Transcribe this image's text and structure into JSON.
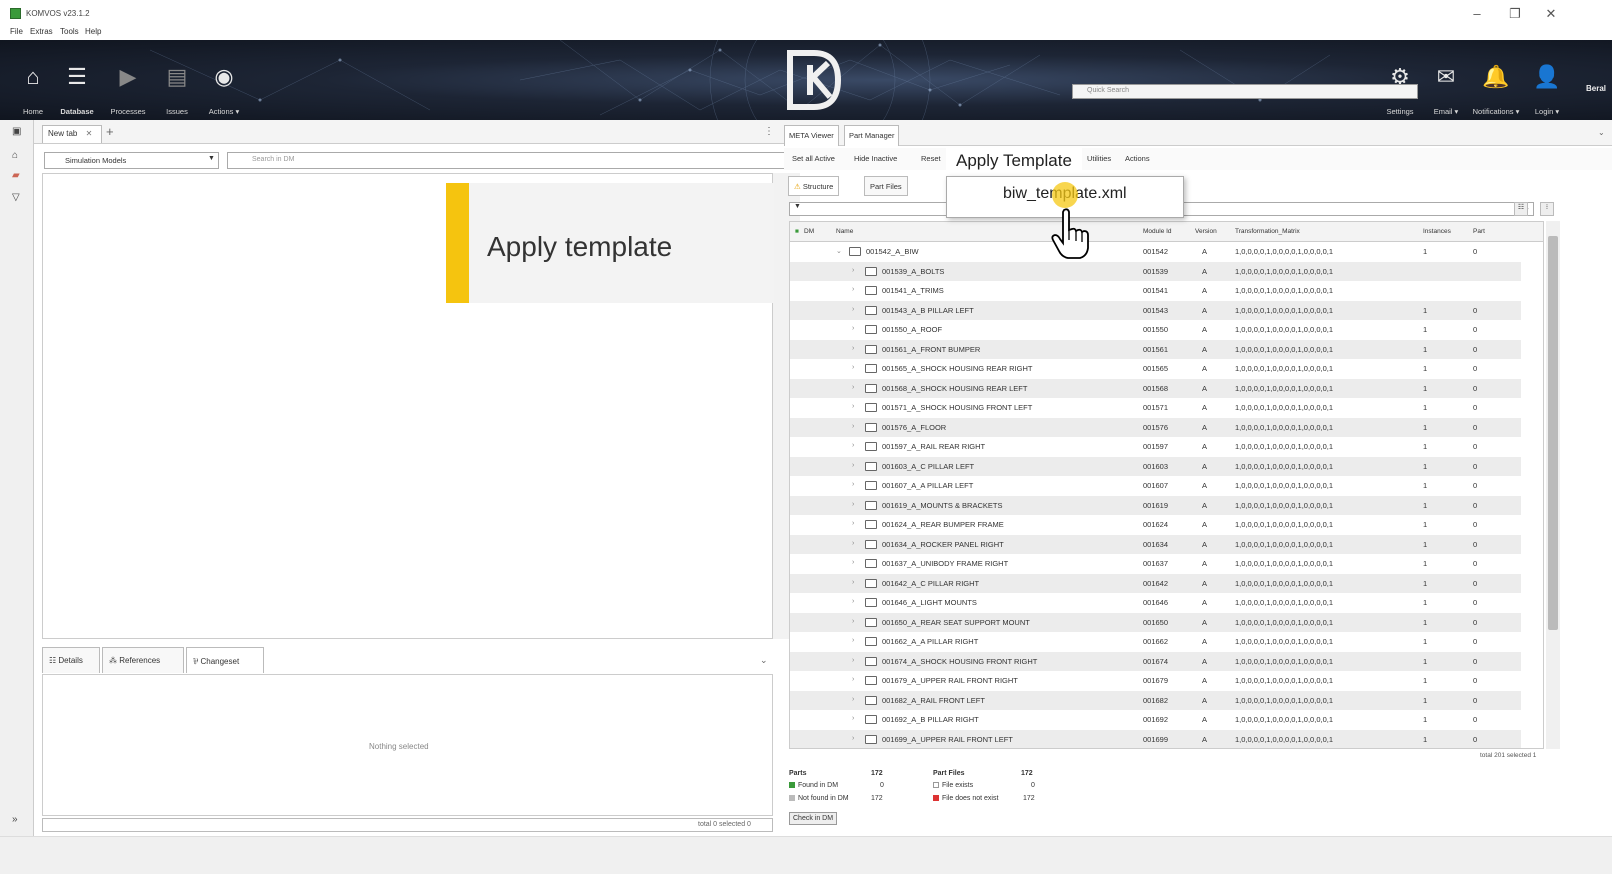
{
  "window": {
    "title": "KOMVOS v23.1.2",
    "minimize": "–",
    "maximize": "❐",
    "close": "✕"
  },
  "menu": [
    "File",
    "Extras",
    "Tools",
    "Help"
  ],
  "toolbar": {
    "items": [
      {
        "label": "Home",
        "icon": "home-icon"
      },
      {
        "label": "Database",
        "icon": "database-icon"
      },
      {
        "label": "Processes",
        "icon": "play-icon"
      },
      {
        "label": "Issues",
        "icon": "document-icon"
      },
      {
        "label": "Actions ▾",
        "icon": "broadcast-icon"
      }
    ],
    "right_items": [
      {
        "label": "Settings",
        "icon": "gear-icon"
      },
      {
        "label": "Email ▾",
        "icon": "email-icon"
      },
      {
        "label": "Notifications ▾",
        "icon": "bell-icon"
      },
      {
        "label": "Login ▾",
        "icon": "user-icon"
      }
    ],
    "quick_search_placeholder": "Quick Search",
    "user": "Beral"
  },
  "left": {
    "tab_label": "New tab",
    "dropdown_value": "Simulation Models",
    "search_placeholder": "Search in DM",
    "bottom_tabs": [
      "Details",
      "References",
      "Changeset"
    ],
    "nothing_selected": "Nothing selected",
    "status": "total 0 selected 0"
  },
  "callout": {
    "text": "Apply template",
    "color": "#f5c40f"
  },
  "right": {
    "tabs": [
      "META Viewer",
      "Part Manager"
    ],
    "toolbar": [
      "Set all Active",
      "Hide Inactive",
      "Reset",
      "Utilities",
      "Actions"
    ],
    "struct_tabs": [
      "Structure",
      "Part Files"
    ],
    "columns": [
      "DM",
      "Name",
      "Module Id",
      "Version",
      "Transformation_Matrix",
      "Instances",
      "Part"
    ],
    "rows": [
      {
        "name": "001542_A_BIW",
        "module": "001542",
        "version": "A",
        "matrix": "1,0,0,0,0,1,0,0,0,0,1,0,0,0,0,1",
        "instances": "1",
        "part": "0",
        "level": 0,
        "expanded": true
      },
      {
        "name": "001539_A_BOLTS",
        "module": "001539",
        "version": "A",
        "matrix": "1,0,0,0,0,1,0,0,0,0,1,0,0,0,0,1",
        "instances": "",
        "part": "",
        "level": 1
      },
      {
        "name": "001541_A_TRIMS",
        "module": "001541",
        "version": "A",
        "matrix": "1,0,0,0,0,1,0,0,0,0,1,0,0,0,0,1",
        "instances": "",
        "part": "",
        "level": 1
      },
      {
        "name": "001543_A_B PILLAR LEFT",
        "module": "001543",
        "version": "A",
        "matrix": "1,0,0,0,0,1,0,0,0,0,1,0,0,0,0,1",
        "instances": "1",
        "part": "0",
        "level": 1
      },
      {
        "name": "001550_A_ROOF",
        "module": "001550",
        "version": "A",
        "matrix": "1,0,0,0,0,1,0,0,0,0,1,0,0,0,0,1",
        "instances": "1",
        "part": "0",
        "level": 1
      },
      {
        "name": "001561_A_FRONT BUMPER",
        "module": "001561",
        "version": "A",
        "matrix": "1,0,0,0,0,1,0,0,0,0,1,0,0,0,0,1",
        "instances": "1",
        "part": "0",
        "level": 1
      },
      {
        "name": "001565_A_SHOCK HOUSING REAR RIGHT",
        "module": "001565",
        "version": "A",
        "matrix": "1,0,0,0,0,1,0,0,0,0,1,0,0,0,0,1",
        "instances": "1",
        "part": "0",
        "level": 1
      },
      {
        "name": "001568_A_SHOCK HOUSING REAR LEFT",
        "module": "001568",
        "version": "A",
        "matrix": "1,0,0,0,0,1,0,0,0,0,1,0,0,0,0,1",
        "instances": "1",
        "part": "0",
        "level": 1
      },
      {
        "name": "001571_A_SHOCK HOUSING FRONT LEFT",
        "module": "001571",
        "version": "A",
        "matrix": "1,0,0,0,0,1,0,0,0,0,1,0,0,0,0,1",
        "instances": "1",
        "part": "0",
        "level": 1
      },
      {
        "name": "001576_A_FLOOR",
        "module": "001576",
        "version": "A",
        "matrix": "1,0,0,0,0,1,0,0,0,0,1,0,0,0,0,1",
        "instances": "1",
        "part": "0",
        "level": 1
      },
      {
        "name": "001597_A_RAIL REAR RIGHT",
        "module": "001597",
        "version": "A",
        "matrix": "1,0,0,0,0,1,0,0,0,0,1,0,0,0,0,1",
        "instances": "1",
        "part": "0",
        "level": 1
      },
      {
        "name": "001603_A_C PILLAR LEFT",
        "module": "001603",
        "version": "A",
        "matrix": "1,0,0,0,0,1,0,0,0,0,1,0,0,0,0,1",
        "instances": "1",
        "part": "0",
        "level": 1
      },
      {
        "name": "001607_A_A PILLAR LEFT",
        "module": "001607",
        "version": "A",
        "matrix": "1,0,0,0,0,1,0,0,0,0,1,0,0,0,0,1",
        "instances": "1",
        "part": "0",
        "level": 1
      },
      {
        "name": "001619_A_MOUNTS & BRACKETS",
        "module": "001619",
        "version": "A",
        "matrix": "1,0,0,0,0,1,0,0,0,0,1,0,0,0,0,1",
        "instances": "1",
        "part": "0",
        "level": 1
      },
      {
        "name": "001624_A_REAR BUMPER FRAME",
        "module": "001624",
        "version": "A",
        "matrix": "1,0,0,0,0,1,0,0,0,0,1,0,0,0,0,1",
        "instances": "1",
        "part": "0",
        "level": 1
      },
      {
        "name": "001634_A_ROCKER PANEL RIGHT",
        "module": "001634",
        "version": "A",
        "matrix": "1,0,0,0,0,1,0,0,0,0,1,0,0,0,0,1",
        "instances": "1",
        "part": "0",
        "level": 1
      },
      {
        "name": "001637_A_UNIBODY FRAME RIGHT",
        "module": "001637",
        "version": "A",
        "matrix": "1,0,0,0,0,1,0,0,0,0,1,0,0,0,0,1",
        "instances": "1",
        "part": "0",
        "level": 1
      },
      {
        "name": "001642_A_C PILLAR RIGHT",
        "module": "001642",
        "version": "A",
        "matrix": "1,0,0,0,0,1,0,0,0,0,1,0,0,0,0,1",
        "instances": "1",
        "part": "0",
        "level": 1
      },
      {
        "name": "001646_A_LIGHT MOUNTS",
        "module": "001646",
        "version": "A",
        "matrix": "1,0,0,0,0,1,0,0,0,0,1,0,0,0,0,1",
        "instances": "1",
        "part": "0",
        "level": 1
      },
      {
        "name": "001650_A_REAR SEAT SUPPORT MOUNT",
        "module": "001650",
        "version": "A",
        "matrix": "1,0,0,0,0,1,0,0,0,0,1,0,0,0,0,1",
        "instances": "1",
        "part": "0",
        "level": 1
      },
      {
        "name": "001662_A_A PILLAR RIGHT",
        "module": "001662",
        "version": "A",
        "matrix": "1,0,0,0,0,1,0,0,0,0,1,0,0,0,0,1",
        "instances": "1",
        "part": "0",
        "level": 1
      },
      {
        "name": "001674_A_SHOCK HOUSING FRONT RIGHT",
        "module": "001674",
        "version": "A",
        "matrix": "1,0,0,0,0,1,0,0,0,0,1,0,0,0,0,1",
        "instances": "1",
        "part": "0",
        "level": 1
      },
      {
        "name": "001679_A_UPPER RAIL FRONT RIGHT",
        "module": "001679",
        "version": "A",
        "matrix": "1,0,0,0,0,1,0,0,0,0,1,0,0,0,0,1",
        "instances": "1",
        "part": "0",
        "level": 1
      },
      {
        "name": "001682_A_RAIL FRONT LEFT",
        "module": "001682",
        "version": "A",
        "matrix": "1,0,0,0,0,1,0,0,0,0,1,0,0,0,0,1",
        "instances": "1",
        "part": "0",
        "level": 1
      },
      {
        "name": "001692_A_B PILLAR RIGHT",
        "module": "001692",
        "version": "A",
        "matrix": "1,0,0,0,0,1,0,0,0,0,1,0,0,0,0,1",
        "instances": "1",
        "part": "0",
        "level": 1
      },
      {
        "name": "001699_A_UPPER RAIL FRONT LEFT",
        "module": "001699",
        "version": "A",
        "matrix": "1,0,0,0,0,1,0,0,0,0,1,0,0,0,0,1",
        "instances": "1",
        "part": "0",
        "level": 1
      }
    ],
    "grid_status": "total 201  selected 1",
    "summary": {
      "parts_label": "Parts",
      "parts_count": "172",
      "found_label": "Found in DM",
      "found_count": "0",
      "notfound_label": "Not found in DM",
      "notfound_count": "172",
      "pf_label": "Part Files",
      "pf_count": "172",
      "exists_label": "File exists",
      "exists_count": "0",
      "notexists_label": "File does not exist",
      "notexists_count": "172",
      "check_button": "Check in DM"
    }
  },
  "popup": {
    "menu_label": "Apply Template",
    "item": "biw_template.xml"
  }
}
